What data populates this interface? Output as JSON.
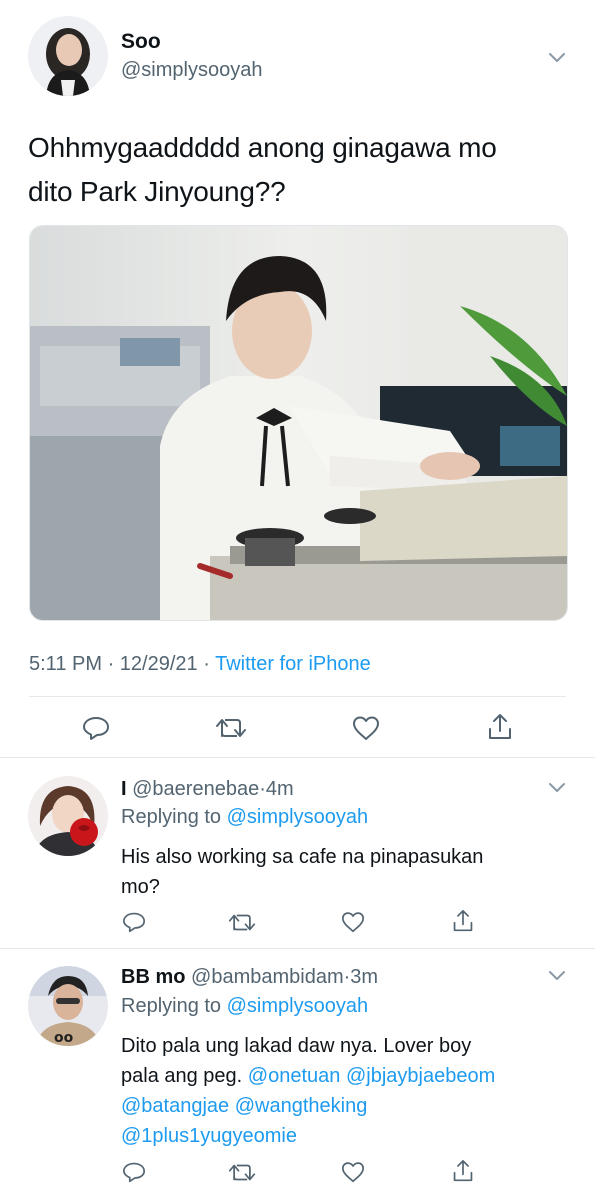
{
  "main_tweet": {
    "author_name": "Soo",
    "author_handle": "@simplysooyah",
    "text_line1": "Ohhmygaaddddd anong ginagawa mo",
    "text_line2": "dito Park Jinyoung??",
    "time": "5:11 PM",
    "date": "12/29/21",
    "source": "Twitter for iPhone",
    "dot": "·",
    "actions": [
      "reply-icon",
      "retweet-icon",
      "like-icon",
      "share-icon"
    ]
  },
  "replies": [
    {
      "name": "I",
      "handle": "@baerenebae",
      "age": "4m",
      "replying_label": "Replying to",
      "replying_to": "@simplysooyah",
      "text_line1": "His also working sa cafe na pinapasukan",
      "text_line2": "mo?"
    },
    {
      "name": "BB mo",
      "handle": "@bambambidam",
      "age": "3m",
      "replying_label": "Replying to",
      "replying_to": "@simplysooyah",
      "text_line1": "Dito pala ung lakad daw nya. Lover boy",
      "text_line2_plain": "pala ang peg.",
      "mention_1": "@onetuan",
      "mention_2": "@jbjaybjaebeom",
      "mention_3": "@batangjae",
      "mention_4": "@wangtheking",
      "mention_5": "@1plus1yugyeomie"
    }
  ],
  "colors": {
    "link": "#1d9bf0",
    "secondary": "#536471",
    "divider": "#e6e9eb"
  }
}
